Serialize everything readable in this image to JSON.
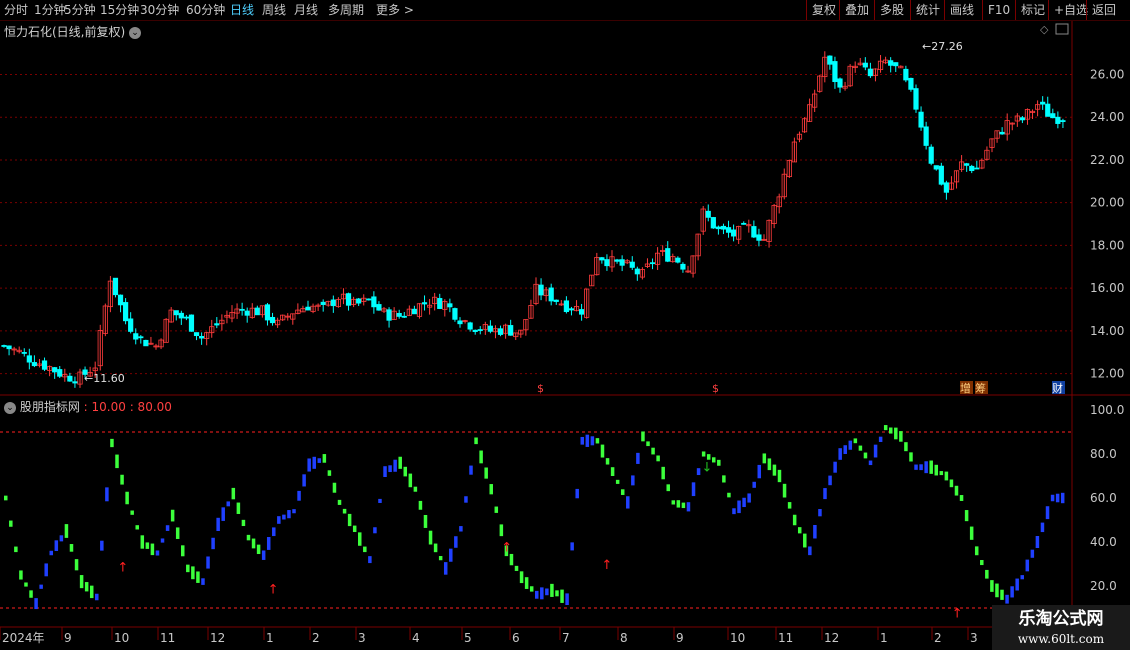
{
  "toolbar": {
    "left": [
      "分时",
      "1分钟",
      "5分钟",
      "15分钟",
      "30分钟",
      "60分钟",
      "日线",
      "周线",
      "月线",
      "多周期",
      "更多 >"
    ],
    "active": "日线",
    "right": [
      "复权",
      "叠加",
      "多股",
      "统计",
      "画线",
      "F10",
      "标记",
      "+自选",
      "返回"
    ]
  },
  "price_panel": {
    "title": "恒力石化(日线,前复权)",
    "max_label": "27.26",
    "min_label": "11.60",
    "markers": {
      "s1": "$",
      "s2": "$",
      "zeng": "增",
      "chou": "筹",
      "cai": "财"
    }
  },
  "indicator_panel": {
    "name": "股朋指标网",
    "params": ": 10.00 : 80.00"
  },
  "watermark": {
    "line1": "乐淘公式网",
    "line2": "www.60lt.com"
  },
  "colors": {
    "up": "#ff3c3c",
    "down": "#00ffff",
    "blue": "#2040ff",
    "green": "#3cff3c",
    "grid": "#7a0000",
    "axis": "#c8c8c8"
  },
  "chart_data": [
    {
      "type": "candlestick",
      "title": "恒力石化(日线,前复权)",
      "ylim": [
        11,
        27.8
      ],
      "y_ticks": [
        12.0,
        14.0,
        16.0,
        18.0,
        20.0,
        22.0,
        24.0,
        26.0
      ],
      "x_ticks": [
        "2024年",
        "9",
        "10",
        "11",
        "12",
        "1",
        "2",
        "3",
        "4",
        "5",
        "6",
        "7",
        "8",
        "9",
        "10",
        "11",
        "12",
        "1",
        "2",
        "3"
      ],
      "close_path": [
        13.3,
        13.0,
        12.6,
        12.3,
        11.9,
        11.8,
        12.4,
        16.5,
        14.5,
        13.6,
        13.3,
        14.9,
        14.5,
        13.7,
        14.3,
        14.9,
        15.0,
        14.9,
        14.3,
        14.9,
        15.2,
        15.0,
        15.6,
        15.2,
        15.4,
        14.8,
        14.7,
        15.1,
        15.4,
        15.3,
        14.6,
        14.2,
        14.0,
        14.1,
        13.9,
        15.9,
        15.6,
        15.2,
        15.0,
        17.6,
        17.2,
        17.0,
        16.6,
        17.6,
        17.5,
        16.9,
        19.5,
        18.7,
        18.5,
        18.8,
        18.3,
        20.5,
        22.9,
        24.3,
        26.8,
        25.3,
        26.6,
        25.9,
        26.6,
        26.1,
        24.5,
        22.0,
        20.5,
        21.8,
        21.6,
        22.9,
        23.7,
        23.9,
        24.6,
        24.0
      ],
      "high": 27.26,
      "low": 11.6
    },
    {
      "type": "line",
      "title": "股朋指标网",
      "ylim": [
        10,
        100
      ],
      "y_ticks": [
        20.0,
        40.0,
        60.0,
        80.0,
        100.0
      ],
      "thresholds": [
        10.0,
        90.0
      ],
      "series": [
        {
          "values": [
            60,
            25,
            12,
            35,
            45,
            22,
            15,
            85,
            60,
            40,
            35,
            52,
            28,
            22,
            48,
            62,
            42,
            34,
            50,
            54,
            75,
            78,
            58,
            46,
            32,
            72,
            76,
            64,
            42,
            28,
            46,
            86,
            64,
            36,
            24,
            16,
            18,
            14,
            86,
            86,
            72,
            58,
            88,
            78,
            58,
            56,
            80,
            76,
            54,
            60,
            78,
            70,
            50,
            36,
            62,
            80,
            86,
            76,
            92,
            88,
            74,
            74,
            70,
            60,
            36,
            20,
            14,
            24,
            40,
            60
          ]
        }
      ],
      "up_arrow_positions": [
        7,
        16,
        30,
        36,
        57,
        76,
        83,
        86,
        89,
        94
      ],
      "down_arrow_positions": [
        42,
        91,
        101
      ]
    }
  ]
}
